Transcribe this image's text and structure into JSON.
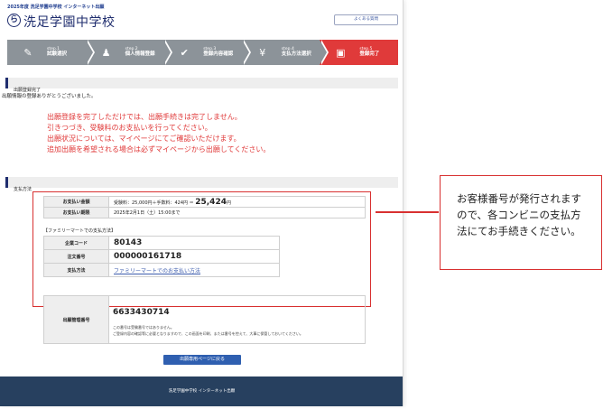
{
  "header": {
    "year_line": "2025年度 洗足学園中学校 インターネット出願",
    "logo_char": "ら",
    "school_name": "洗足学園中学校",
    "faq_button": "よくある質問"
  },
  "steps": [
    {
      "num": "step.1",
      "label": "試験選択",
      "icon": "pencil-icon",
      "glyph": "✎"
    },
    {
      "num": "step.2",
      "label": "個人情報登録",
      "icon": "person-icon",
      "glyph": "♟"
    },
    {
      "num": "step.3",
      "label": "登録内容確認",
      "icon": "check-icon",
      "glyph": "✔"
    },
    {
      "num": "step.4",
      "label": "支払方法選択",
      "icon": "yen-icon",
      "glyph": "¥"
    },
    {
      "num": "step.5",
      "label": "登録完了",
      "icon": "monitor-icon",
      "glyph": "▣"
    }
  ],
  "active_step": 5,
  "colors": {
    "accent": "#e03a3a",
    "navy": "#1f2d6e",
    "step_gray": "#8c9399",
    "footer": "#27405f",
    "link": "#3c5cad"
  },
  "section_complete": {
    "title": "出願登録完了",
    "thanks": "出願情報の登録ありがとうございました。",
    "messages": [
      "出願登録を完了しただけでは、出願手続きは完了しません。",
      "引きつづき、受験料のお支払いを行ってください。",
      "出願状況については、マイページにてご確認いただけます。",
      "追加出願を希望される場合は必ずマイページから出願してください。"
    ]
  },
  "section_payment": {
    "title": "支払方法",
    "amount_label": "お支払い金額",
    "amount_breakdown": "受験料：25,000円＋手数料：424円 ＝",
    "amount_total": "25,424",
    "amount_unit": "円",
    "deadline_label": "お支払い期限",
    "deadline_value": "2025年2月1日（土）15:00まで",
    "famima_title": "【ファミリーマートでの支払方法】",
    "company_code_label": "企業コード",
    "company_code": "80143",
    "order_no_label": "注文番号",
    "order_no": "000000161718",
    "method_label": "支払方法",
    "method_link": "ファミリーマートでのお支払い方法"
  },
  "management": {
    "label": "出願管理番号",
    "number": "6633430714",
    "note1": "この番号は受験番号ではありません。",
    "note2": "ご登録内容の確認等に必要となりますので、この画面を印刷、または番号を控えて、大事に保管しておいてください。"
  },
  "back_button": "出願専用ページに戻る",
  "footer": "洗足学園中学校 インターネット出願",
  "callout": "お客様番号が発行されますので、各コンビニの支払方法にてお手続きください。"
}
